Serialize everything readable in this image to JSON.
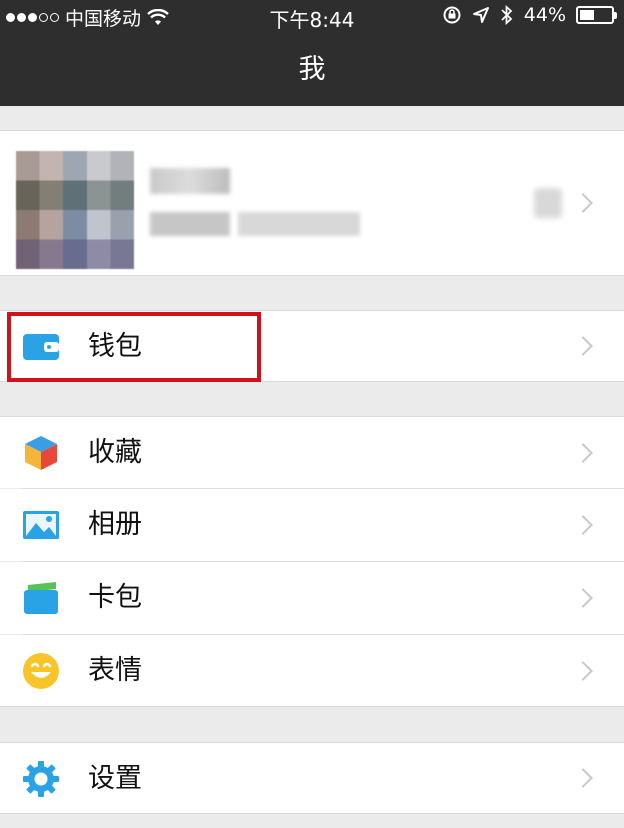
{
  "status_bar": {
    "carrier": "中国移动",
    "time": "下午8:44",
    "battery": "44%"
  },
  "nav": {
    "title": "我"
  },
  "menu": {
    "wallet": "钱包",
    "favorites": "收藏",
    "album": "相册",
    "cards": "卡包",
    "stickers": "表情",
    "settings": "设置"
  },
  "icons": {
    "wallet": "wallet-icon",
    "favorites": "cube-icon",
    "album": "image-icon",
    "cards": "card-icon",
    "stickers": "smiley-icon",
    "settings": "gear-icon"
  },
  "colors": {
    "bar": "#2e2e2e",
    "highlight": "#d0121b",
    "accent_blue": "#2aa3e6",
    "smiley": "#f7c42a"
  }
}
